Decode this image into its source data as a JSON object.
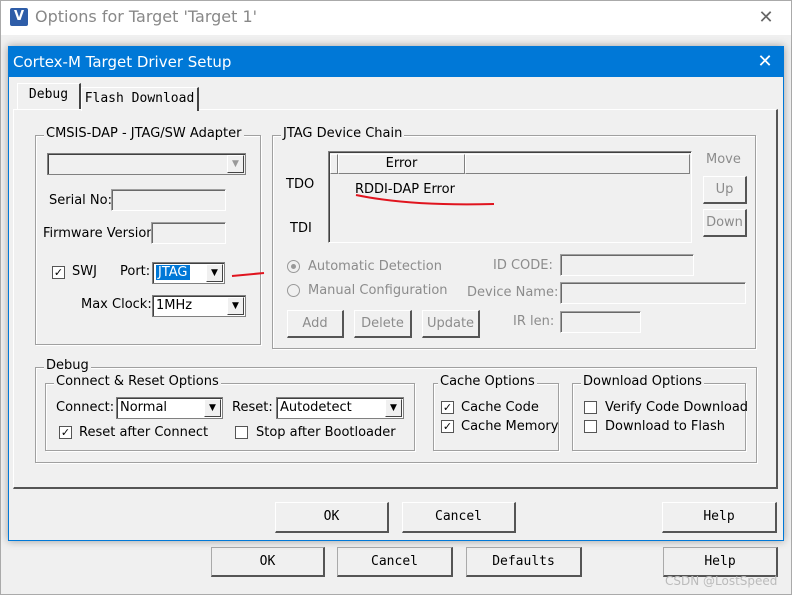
{
  "back_window": {
    "title": "Options for Target 'Target 1'",
    "buttons": {
      "ok": "OK",
      "cancel": "Cancel",
      "defaults": "Defaults",
      "help": "Help"
    },
    "watermark": "CSDN @LostSpeed"
  },
  "dialog": {
    "title": "Cortex-M Target Driver Setup",
    "tabs": [
      {
        "label": "Debug",
        "active": true
      },
      {
        "label": "Flash Download",
        "active": false
      }
    ],
    "adapter": {
      "group_label": "CMSIS-DAP - JTAG/SW Adapter",
      "adapter_value": "",
      "serial_label": "Serial No:",
      "serial_value": "",
      "firmware_label": "Firmware Version:",
      "firmware_value": "",
      "swj_label": "SWJ",
      "swj_checked": true,
      "port_label": "Port:",
      "port_value": "JTAG",
      "maxclock_label": "Max Clock:",
      "maxclock_value": "1MHz"
    },
    "chain": {
      "group_label": "JTAG Device Chain",
      "column_error": "Error",
      "tdo_label": "TDO",
      "tdi_label": "TDI",
      "error_text": "RDDI-DAP Error",
      "move_label": "Move",
      "up_label": "Up",
      "down_label": "Down",
      "auto_detect_label": "Automatic Detection",
      "manual_config_label": "Manual Configuration",
      "idcode_label": "ID CODE:",
      "device_name_label": "Device Name:",
      "ir_len_label": "IR len:",
      "add_label": "Add",
      "delete_label": "Delete",
      "update_label": "Update"
    },
    "debug": {
      "group_label": "Debug",
      "connect_reset": {
        "group_label": "Connect & Reset Options",
        "connect_label": "Connect:",
        "connect_value": "Normal",
        "reset_label": "Reset:",
        "reset_value": "Autodetect",
        "reset_after_connect_label": "Reset after Connect",
        "reset_after_connect_checked": true,
        "stop_after_bootloader_label": "Stop after Bootloader",
        "stop_after_bootloader_checked": false
      },
      "cache": {
        "group_label": "Cache Options",
        "cache_code_label": "Cache Code",
        "cache_code_checked": true,
        "cache_memory_label": "Cache Memory",
        "cache_memory_checked": true
      },
      "download": {
        "group_label": "Download Options",
        "verify_label": "Verify Code Download",
        "verify_checked": false,
        "flash_label": "Download to Flash",
        "flash_checked": false
      }
    },
    "buttons": {
      "ok": "OK",
      "cancel": "Cancel",
      "help": "Help"
    }
  },
  "colors": {
    "title_blue": "#0078d7",
    "annotation_red": "#e0141e"
  }
}
